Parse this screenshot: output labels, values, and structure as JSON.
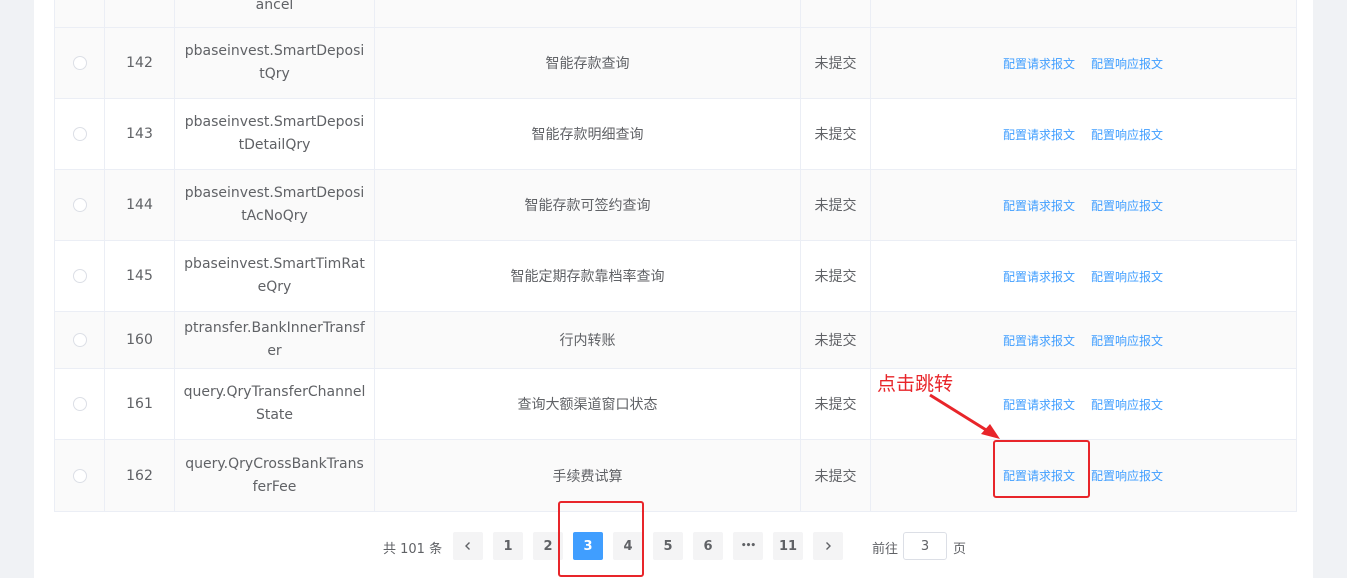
{
  "table": {
    "top_fragment": "ancel",
    "rows": [
      {
        "id": "142",
        "code": "pbaseinvest.SmartDepositQry",
        "name": "智能存款查询",
        "status": "未提交"
      },
      {
        "id": "143",
        "code": "pbaseinvest.SmartDepositDetailQry",
        "name": "智能存款明细查询",
        "status": "未提交"
      },
      {
        "id": "144",
        "code": "pbaseinvest.SmartDepositAcNoQry",
        "name": "智能存款可签约查询",
        "status": "未提交"
      },
      {
        "id": "145",
        "code": "pbaseinvest.SmartTimRateQry",
        "name": "智能定期存款靠档率查询",
        "status": "未提交"
      },
      {
        "id": "160",
        "code": "ptransfer.BankInnerTransfer",
        "name": "行内转账",
        "status": "未提交"
      },
      {
        "id": "161",
        "code": "query.QryTransferChannelState",
        "name": "查询大额渠道窗口状态",
        "status": "未提交"
      },
      {
        "id": "162",
        "code": "query.QryCrossBankTransferFee",
        "name": "手续费试算",
        "status": "未提交"
      }
    ],
    "ops": {
      "request_label": "配置请求报文",
      "response_label": "配置响应报文"
    }
  },
  "pagination": {
    "total": "共 101 条",
    "prev_icon": "chevron-left-icon",
    "next_icon": "chevron-right-icon",
    "pages": [
      "1",
      "2",
      "3",
      "4",
      "5",
      "6",
      "•••",
      "11"
    ],
    "current_page": "3",
    "goto_label": "前往",
    "goto_value": "3",
    "goto_suffix": "页"
  },
  "annotation": {
    "text": "点击跳转",
    "color": "#e8252a"
  }
}
